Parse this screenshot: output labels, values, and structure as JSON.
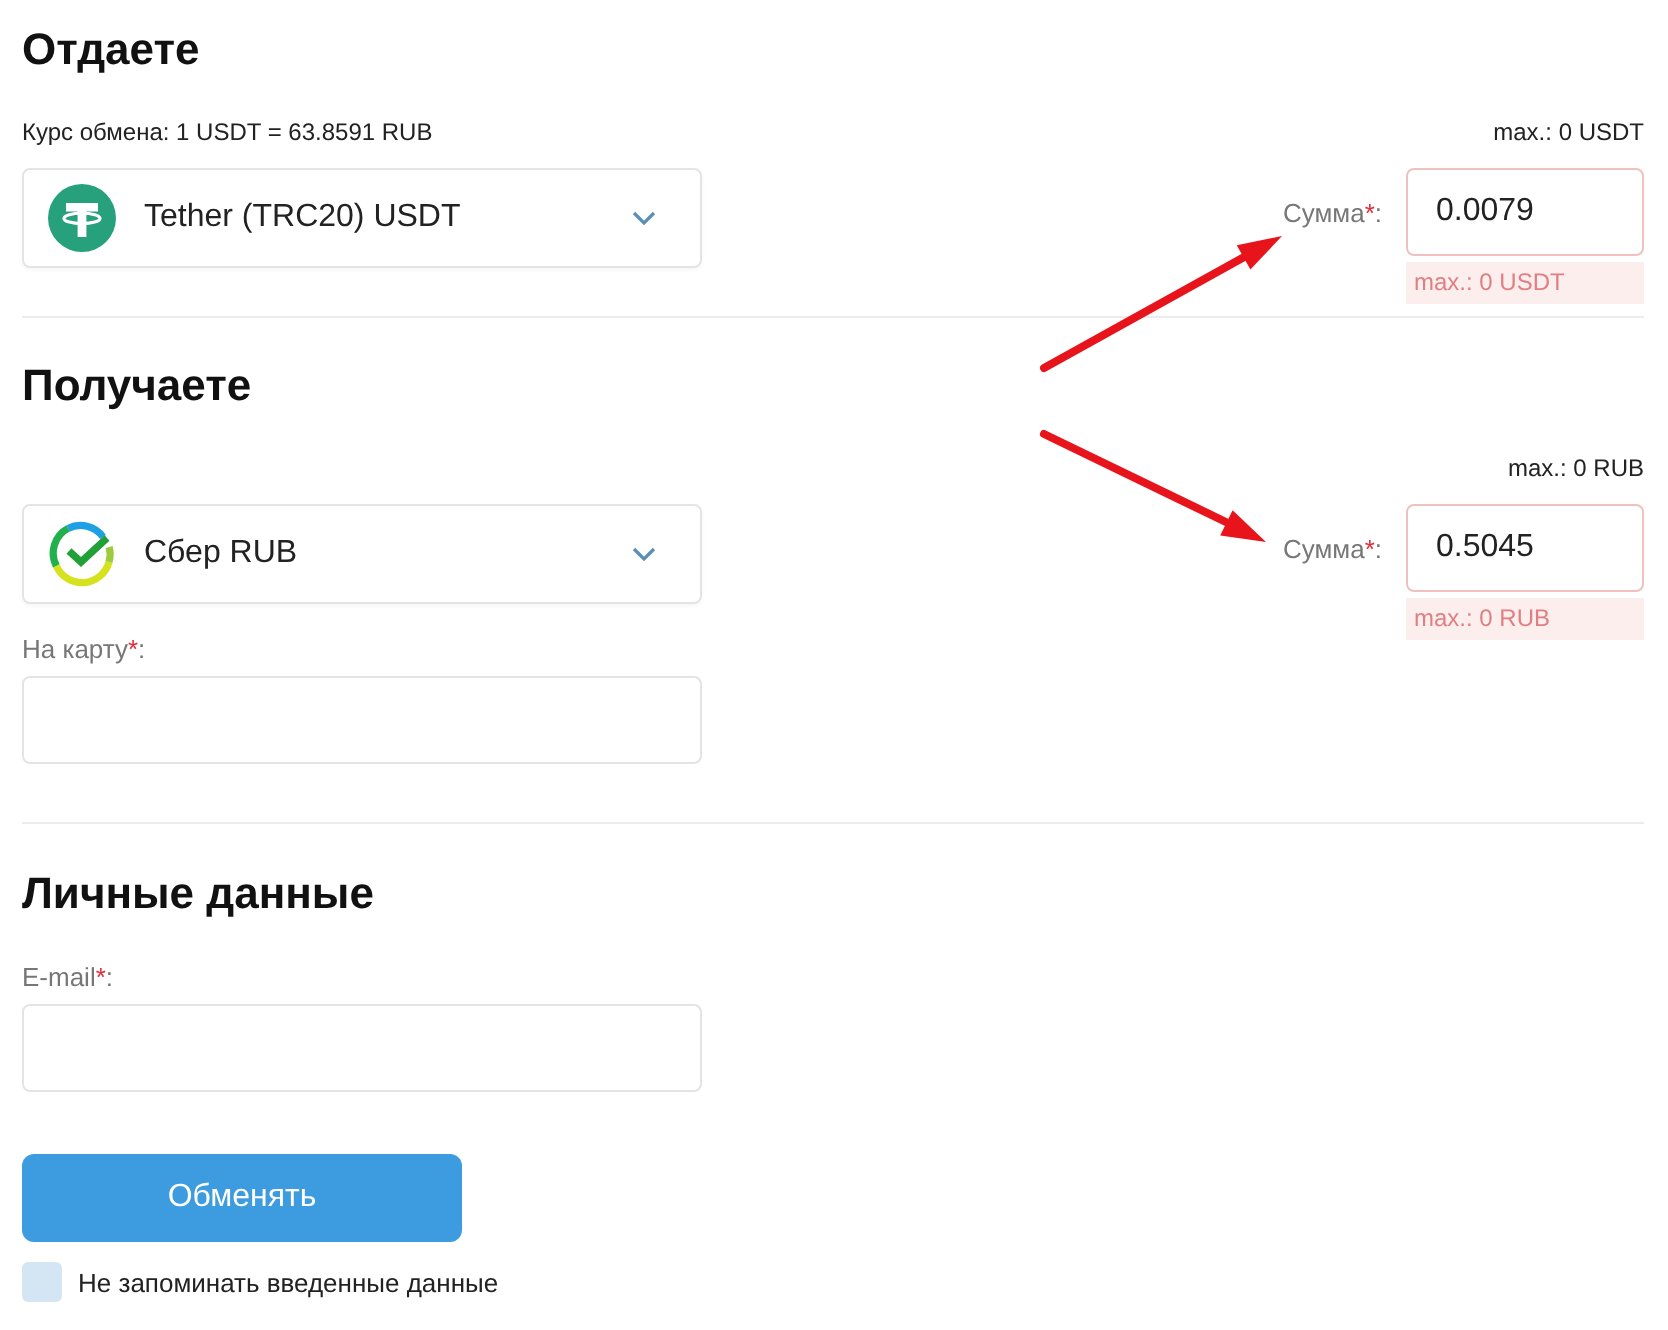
{
  "give": {
    "title": "Отдаете",
    "rate": "Курс обмена: 1 USDT = 63.8591 RUB",
    "max": "max.: 0 USDT",
    "currency": "Tether (TRC20) USDT",
    "amount": {
      "label": "Сумма",
      "required_mark": "*",
      "suffix": ":",
      "value": "0.0079",
      "invalid": true,
      "error": "max.: 0 USDT"
    }
  },
  "receive": {
    "title": "Получаете",
    "max": "max.: 0 RUB",
    "currency": "Сбер RUB",
    "amount": {
      "label": "Сумма",
      "required_mark": "*",
      "suffix": ":",
      "value": "0.5045",
      "invalid": true,
      "error": "max.: 0 RUB"
    },
    "card": {
      "label": "На карту",
      "required_mark": "*",
      "suffix": ":"
    }
  },
  "personal": {
    "title": "Личные данные",
    "email": {
      "label": "E-mail",
      "required_mark": "*",
      "suffix": ":"
    }
  },
  "submit": "Обменять",
  "remember": {
    "label": "Не запоминать введенные данные",
    "checked": false
  }
}
